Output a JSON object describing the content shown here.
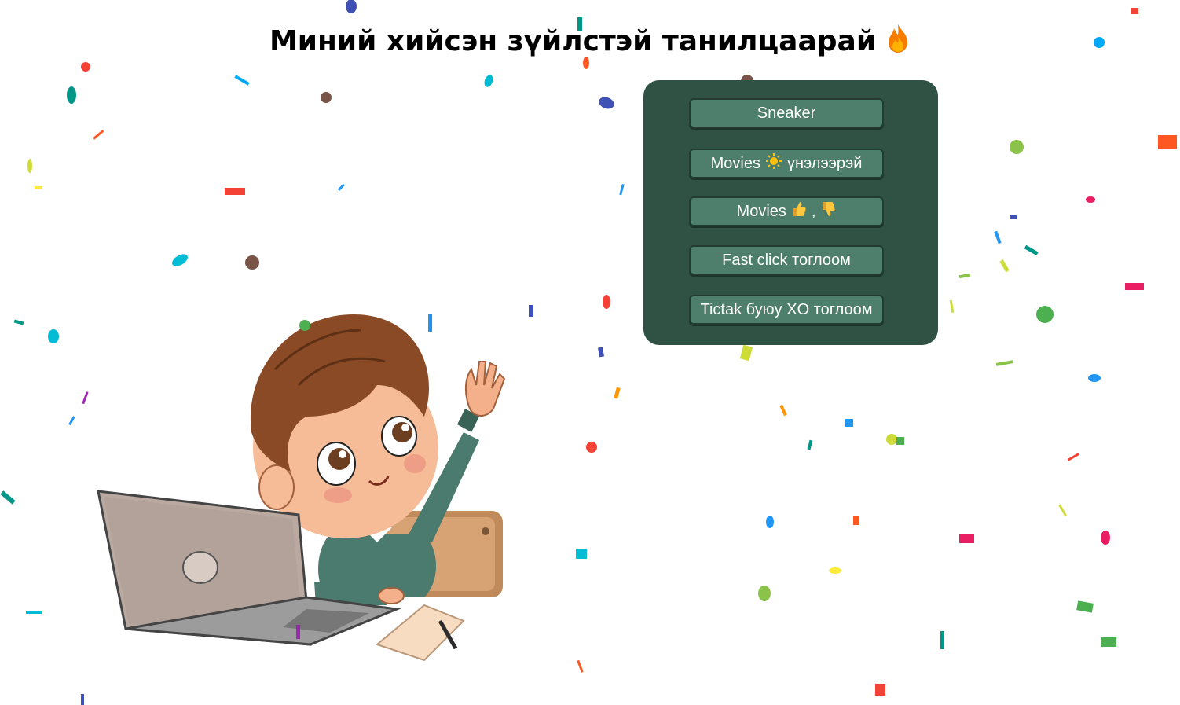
{
  "page": {
    "title": "Миний хийсэн зүйлстэй танилцаарай",
    "title_icon": "fire-icon"
  },
  "menu": {
    "panel_color": "#2f5244",
    "button_color": "#4e7e6c",
    "buttons": [
      {
        "label": "Sneaker"
      },
      {
        "label_before": "Movies",
        "icon": "sun-icon",
        "label_after": "үнэлээрэй"
      },
      {
        "label_before": "Movies",
        "icon": "thumbs-up-icon",
        "separator": ",",
        "icon2": "thumbs-down-icon"
      },
      {
        "label": "Fast click тоглоом"
      },
      {
        "label": "Tictak буюу XO тоглоом"
      }
    ]
  },
  "illustration": {
    "name": "boy-with-laptop-illustration"
  }
}
